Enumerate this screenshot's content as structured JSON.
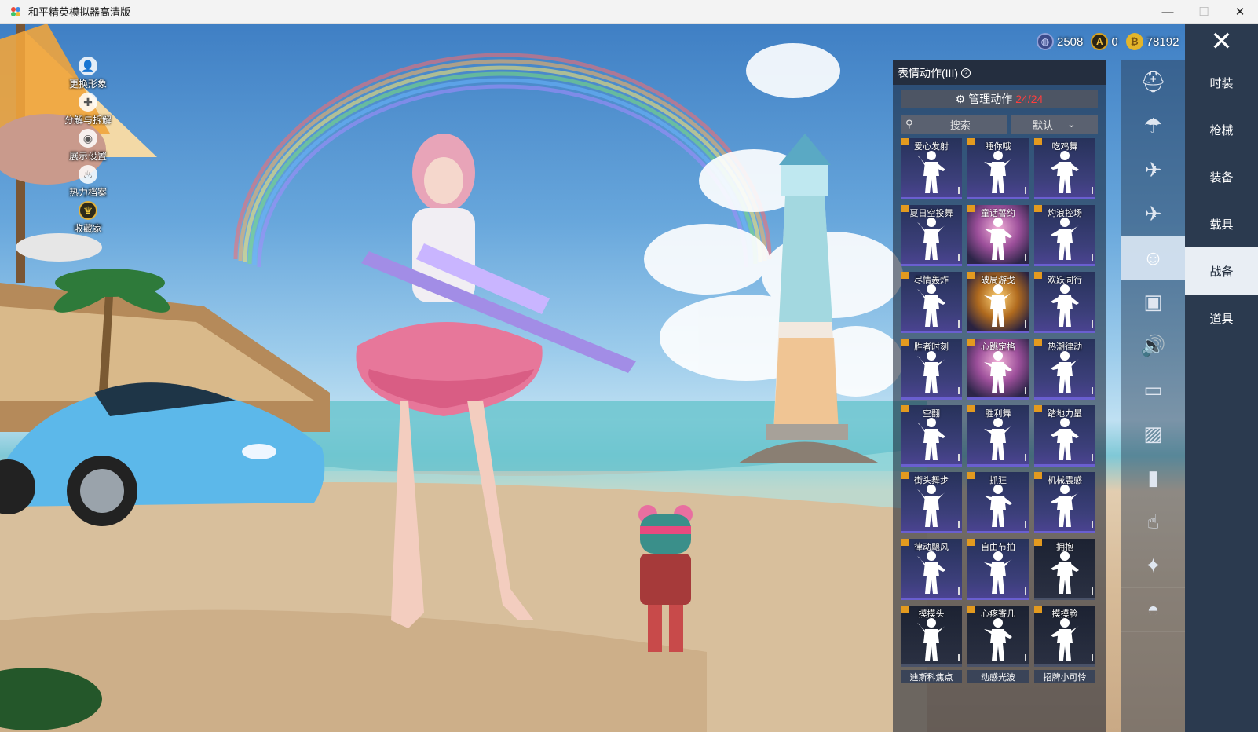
{
  "window": {
    "title": "和平精英模拟器高清版",
    "minimize": "—",
    "maximize": "☐",
    "close": "✕"
  },
  "quick_menu": [
    {
      "label": "更换形象",
      "icon": "person-icon"
    },
    {
      "label": "分解与拆解",
      "icon": "puzzle-icon"
    },
    {
      "label": "展示设置",
      "icon": "eye-icon"
    },
    {
      "label": "热力档案",
      "icon": "flame-icon"
    },
    {
      "label": "收藏家",
      "icon": "collector-badge-icon"
    }
  ],
  "currency": [
    {
      "icon": "globe-coin-icon",
      "value": "2508",
      "color": "#3b4a8a"
    },
    {
      "icon": "a-coin-icon",
      "value": "0",
      "color": "#d9a21e"
    },
    {
      "icon": "gold-coin-icon",
      "value": "78192",
      "color": "#e3b52a"
    }
  ],
  "close_game": "✕",
  "panel": {
    "title": "表情动作(III)",
    "help": "?",
    "manage_label": "管理动作",
    "manage_count": "24/24",
    "search_placeholder": "搜索",
    "sort_value": "默认",
    "emotes": [
      {
        "name": "爱心发射",
        "style": "normal"
      },
      {
        "name": "睡你哦",
        "style": "normal"
      },
      {
        "name": "吃鸡舞",
        "style": "normal"
      },
      {
        "name": "夏日空投舞",
        "style": "normal"
      },
      {
        "name": "童话誓约",
        "style": "pink"
      },
      {
        "name": "灼浪控场",
        "style": "normal"
      },
      {
        "name": "尽情轰炸",
        "style": "normal"
      },
      {
        "name": "破局游戈",
        "style": "gold"
      },
      {
        "name": "欢跃同行",
        "style": "normal"
      },
      {
        "name": "胜者时刻",
        "style": "normal"
      },
      {
        "name": "心跳定格",
        "style": "pink"
      },
      {
        "name": "热潮律动",
        "style": "normal"
      },
      {
        "name": "空翻",
        "style": "normal"
      },
      {
        "name": "胜利舞",
        "style": "normal"
      },
      {
        "name": "踏地力量",
        "style": "normal"
      },
      {
        "name": "街头舞步",
        "style": "normal"
      },
      {
        "name": "抓狂",
        "style": "normal"
      },
      {
        "name": "机械震感",
        "style": "normal"
      },
      {
        "name": "律动飓风",
        "style": "normal"
      },
      {
        "name": "自由节拍",
        "style": "normal"
      },
      {
        "name": "拥抱",
        "style": "dark"
      },
      {
        "name": "摸摸头",
        "style": "dark"
      },
      {
        "name": "心疼寄几",
        "style": "dark"
      },
      {
        "name": "摸摸脸",
        "style": "dark"
      }
    ],
    "bottom_labels": [
      "迪斯科焦点",
      "动感光波",
      "招牌小可怜"
    ]
  },
  "icon_column": [
    {
      "icon": "helmet-icon",
      "active": false
    },
    {
      "icon": "parachute-icon",
      "active": false
    },
    {
      "icon": "drone-icon",
      "active": false
    },
    {
      "icon": "plane-icon",
      "active": false
    },
    {
      "icon": "smiley-icon",
      "active": true
    },
    {
      "icon": "crate-icon",
      "active": false
    },
    {
      "icon": "speaker-icon",
      "active": false
    },
    {
      "icon": "chat-bubble-icon",
      "active": false
    },
    {
      "icon": "gallery-icon",
      "active": false
    },
    {
      "icon": "spray-icon",
      "active": false
    },
    {
      "icon": "tap-icon",
      "active": false
    },
    {
      "icon": "magic-wand-icon",
      "active": false
    },
    {
      "icon": "chicken-icon",
      "active": false
    }
  ],
  "categories": [
    {
      "label": "时装",
      "active": false
    },
    {
      "label": "枪械",
      "active": false
    },
    {
      "label": "装备",
      "active": false
    },
    {
      "label": "载具",
      "active": false
    },
    {
      "label": "战备",
      "active": true
    },
    {
      "label": "道具",
      "active": false
    }
  ]
}
